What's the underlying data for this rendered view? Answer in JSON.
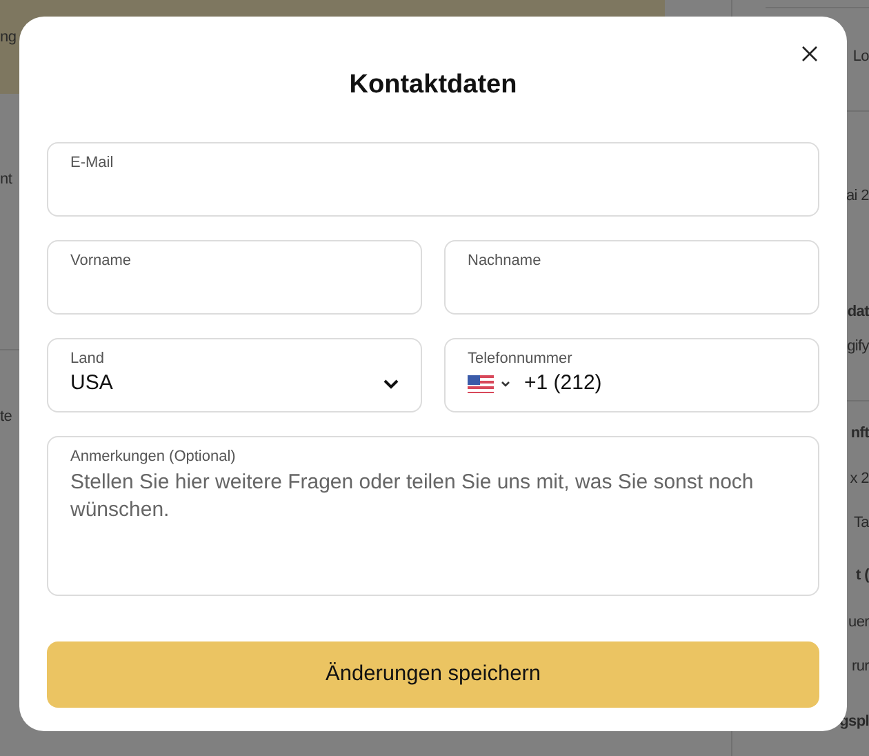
{
  "background": {
    "left_fragments": [
      "ng",
      "nt",
      "te"
    ],
    "right_fragments": [
      {
        "text": "Lo",
        "bold": false
      },
      {
        "text": "ai 2",
        "bold": false
      },
      {
        "text": "dat",
        "bold": true
      },
      {
        "text": "gify",
        "bold": false
      },
      {
        "text": "nft",
        "bold": true
      },
      {
        "text": "x 2",
        "bold": false
      },
      {
        "text": "Ta",
        "bold": false
      },
      {
        "text": "t (",
        "bold": true
      },
      {
        "text": "uer",
        "bold": false
      },
      {
        "text": "rur",
        "bold": false
      },
      {
        "text": "gspl",
        "bold": true
      }
    ]
  },
  "dialog": {
    "title": "Kontaktdaten",
    "rows": [
      [
        {
          "kind": "text",
          "label": "E-Mail"
        }
      ],
      [
        {
          "kind": "text",
          "label": "Vorname"
        },
        {
          "kind": "text",
          "label": "Nachname"
        }
      ],
      [
        {
          "kind": "select",
          "label": "Land",
          "value": "USA"
        },
        {
          "kind": "phone",
          "label": "Telefonnummer",
          "value": "+1 (212)"
        }
      ],
      [
        {
          "kind": "textarea",
          "label": "Anmerkungen (Optional)",
          "placeholder": "Stellen Sie hier weitere Fragen oder teilen Sie uns mit, was Sie sonst noch wünschen."
        }
      ]
    ],
    "save_button": "Änderungen speichern"
  }
}
